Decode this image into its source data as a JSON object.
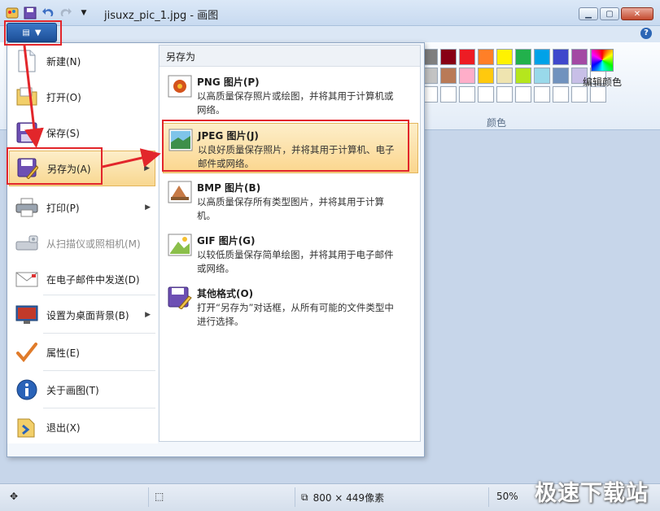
{
  "window": {
    "title": "jisuxz_pic_1.jpg - 画图",
    "buttons": [
      "minimize",
      "maximize",
      "close"
    ],
    "help": "?"
  },
  "ribbon": {
    "edit_colors_label": "编辑颜色",
    "colors_group_label": "颜色",
    "palette_row1": [
      "#7f7f7f",
      "#880015",
      "#ed1c24",
      "#ff7f27",
      "#fff200",
      "#22b14c",
      "#00a2e8",
      "#3f48cc",
      "#a349a4"
    ],
    "palette_row2": [
      "#c3c3c3",
      "#b97a57",
      "#ffaec9",
      "#ffc90e",
      "#efe4b0",
      "#b5e61d",
      "#99d9ea",
      "#7092be",
      "#c8bfe7"
    ]
  },
  "menu": {
    "items": [
      {
        "label": "新建(N)",
        "icon": "new-document-icon",
        "arrow": false
      },
      {
        "label": "打开(O)",
        "icon": "open-folder-icon",
        "arrow": false
      },
      {
        "label": "保存(S)",
        "icon": "floppy-disk-icon",
        "arrow": false
      },
      {
        "label": "另存为(A)",
        "icon": "save-as-icon",
        "arrow": true
      },
      {
        "label": "打印(P)",
        "icon": "printer-icon",
        "arrow": true
      },
      {
        "label": "从扫描仪或照相机(M)",
        "icon": "scanner-icon",
        "arrow": false
      },
      {
        "label": "在电子邮件中发送(D)",
        "icon": "email-icon",
        "arrow": false
      },
      {
        "label": "设置为桌面背景(B)",
        "icon": "desktop-background-icon",
        "arrow": true
      },
      {
        "label": "属性(E)",
        "icon": "checkmark-icon",
        "arrow": false
      },
      {
        "label": "关于画图(T)",
        "icon": "info-icon",
        "arrow": false
      },
      {
        "label": "退出(X)",
        "icon": "exit-icon",
        "arrow": false
      }
    ],
    "submenu_title": "另存为",
    "submenu_items": [
      {
        "title": "PNG 图片(P)",
        "desc": "以高质量保存照片或绘图，并将其用于计算机或网络。",
        "icon": "png-image-icon"
      },
      {
        "title": "JPEG 图片(J)",
        "desc": "以良好质量保存照片，并将其用于计算机、电子邮件或网络。",
        "icon": "jpeg-image-icon"
      },
      {
        "title": "BMP 图片(B)",
        "desc": "以高质量保存所有类型图片，并将其用于计算机。",
        "icon": "bmp-image-icon"
      },
      {
        "title": "GIF 图片(G)",
        "desc": "以较低质量保存简单绘图，并将其用于电子邮件或网络。",
        "icon": "gif-image-icon"
      },
      {
        "title": "其他格式(O)",
        "desc": "打开“另存为”对话框，从所有可能的文件类型中进行选择。",
        "icon": "other-formats-icon"
      }
    ]
  },
  "status": {
    "dimensions": "800 × 449像素",
    "zoom": "50%"
  },
  "watermark": "极速下载站"
}
